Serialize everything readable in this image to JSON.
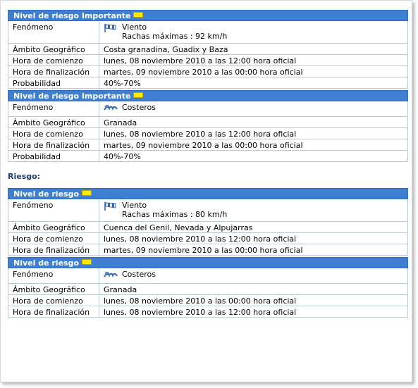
{
  "section_title": "Riesgo:",
  "labels": {
    "fenomeno": "Fenómeno",
    "ambito": "Ámbito Geográfico",
    "comienzo": "Hora de comienzo",
    "finalizacion": "Hora de finalización",
    "probabilidad": "Probabilidad"
  },
  "colors": {
    "header_bg": "#3f7fd2",
    "badge_yellow": "#ffea00"
  },
  "warnings": [
    {
      "header": "Nivel de riesgo Importante",
      "phenomenon_icon": "wind-flag-icon",
      "phenomenon": "Viento",
      "phenomenon_detail": "Rachas máximas : 92 km/h",
      "ambito": "Costa granadina, Guadix y Baza",
      "comienzo": "lunes, 08 noviembre 2010 a las 12:00 hora oficial",
      "finalizacion": "martes, 09 noviembre 2010 a las 00:00 hora oficial",
      "probabilidad": "40%-70%"
    },
    {
      "header": "Nivel de riesgo Importante",
      "phenomenon_icon": "waves-icon",
      "phenomenon": "Costeros",
      "ambito": "Granada",
      "comienzo": "lunes, 08 noviembre 2010 a las 12:00 hora oficial",
      "finalizacion": "martes, 09 noviembre 2010 a las 00:00 hora oficial",
      "probabilidad": "40%-70%"
    },
    {
      "header": "Nivel de riesgo",
      "phenomenon_icon": "wind-flag-icon",
      "phenomenon": "Viento",
      "phenomenon_detail": "Rachas máximas : 80 km/h",
      "ambito": "Cuenca del Genil, Nevada y Alpujarras",
      "comienzo": "lunes, 08 noviembre 2010 a las 12:00 hora oficial",
      "finalizacion": "martes, 09 noviembre 2010 a las 00:00 hora oficial"
    },
    {
      "header": "Nivel de riesgo",
      "phenomenon_icon": "waves-icon",
      "phenomenon": "Costeros",
      "ambito": "Granada",
      "comienzo": "lunes, 08 noviembre 2010 a las 00:00 hora oficial",
      "finalizacion": "lunes, 08 noviembre 2010 a las 12:00 hora oficial"
    }
  ]
}
